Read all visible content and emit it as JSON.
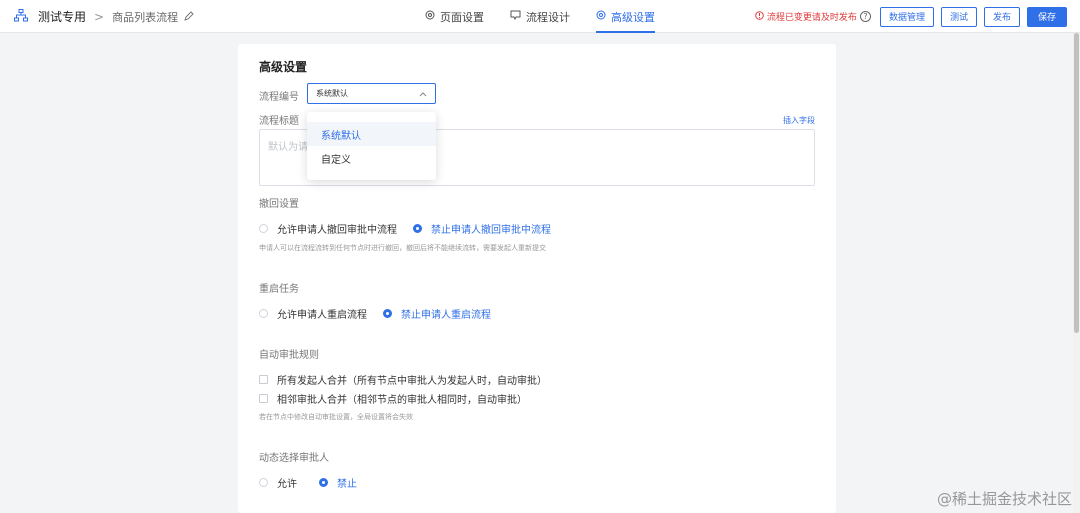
{
  "header": {
    "app_name": "测试专用",
    "separator": ">",
    "flow_name": "商品列表流程",
    "tabs": [
      {
        "label": "页面设置",
        "icon": "gear-icon"
      },
      {
        "label": "流程设计",
        "icon": "flow-icon"
      },
      {
        "label": "高级设置",
        "icon": "gear-icon",
        "active": true
      }
    ],
    "warning": "流程已变更请及时发布",
    "help_icon": "?",
    "buttons": {
      "data_manage": "数据管理",
      "test": "测试",
      "publish": "发布",
      "save": "保存"
    }
  },
  "colors": {
    "accent": "#2f6fe8",
    "warning": "#e03a3a"
  },
  "card": {
    "title": "高级设置",
    "flow_number": {
      "label": "流程编号",
      "value": "系统默认",
      "options": [
        "系统默认",
        "自定义"
      ]
    },
    "flow_title": {
      "label": "流程标题",
      "insert_field": "插入字段",
      "placeholder": "默认为请"
    },
    "withdraw": {
      "label": "撤回设置",
      "options": [
        "允许申请人撤回审批中流程",
        "禁止申请人撤回审批中流程"
      ],
      "selected": 1,
      "hint": "申请人可以在流程流转到任何节点时进行撤回，撤回后将不能继续流转，需要发起人重新提交"
    },
    "restart": {
      "label": "重启任务",
      "options": [
        "允许申请人重启流程",
        "禁止申请人重启流程"
      ],
      "selected": 1
    },
    "auto_approve": {
      "label": "自动审批规则",
      "options": [
        "所有发起人合并（所有节点中审批人为发起人时，自动审批）",
        "相邻审批人合并（相邻节点的审批人相同时，自动审批）"
      ],
      "hint": "若在节点中修改自动审批设置，全局设置将会失效"
    },
    "dynamic": {
      "label": "动态选择审批人",
      "options": [
        "允许",
        "禁止"
      ],
      "selected": 1
    }
  },
  "watermark": "@稀土掘金技术社区"
}
